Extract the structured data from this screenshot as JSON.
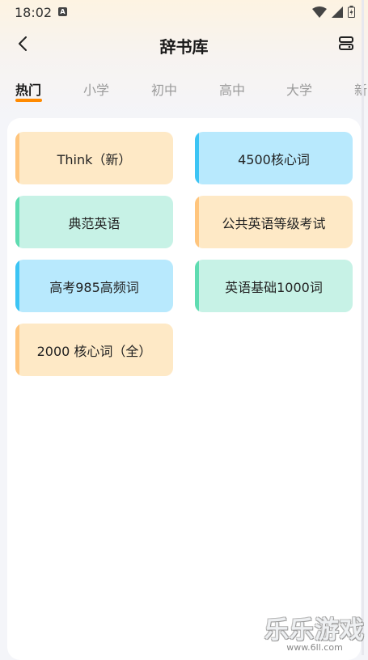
{
  "status_bar": {
    "time": "18:02",
    "notification_icon": "a-icon"
  },
  "header": {
    "title": "辞书库",
    "back_icon": "chevron-left-icon",
    "menu_icon": "layers-icon"
  },
  "tabs": [
    {
      "label": "热门",
      "active": true
    },
    {
      "label": "小学",
      "active": false
    },
    {
      "label": "初中",
      "active": false
    },
    {
      "label": "高中",
      "active": false
    },
    {
      "label": "大学",
      "active": false
    },
    {
      "label": "新",
      "active": false
    }
  ],
  "books": [
    {
      "label": "Think（新）",
      "color": "orange"
    },
    {
      "label": "4500核心词",
      "color": "blue"
    },
    {
      "label": "典范英语",
      "color": "green"
    },
    {
      "label": "公共英语等级考试",
      "color": "orange"
    },
    {
      "label": "高考985高频词",
      "color": "blue"
    },
    {
      "label": "英语基础1000词",
      "color": "green"
    },
    {
      "label": "2000 核心词（全）",
      "color": "orange"
    }
  ],
  "colors": {
    "accent": "#ff8a00",
    "orange_card": "#fee9c6",
    "blue_card": "#b8e9fd",
    "green_card": "#c7f2e6"
  },
  "watermark": {
    "text": "乐乐游戏",
    "url": "www.6ll.com"
  }
}
